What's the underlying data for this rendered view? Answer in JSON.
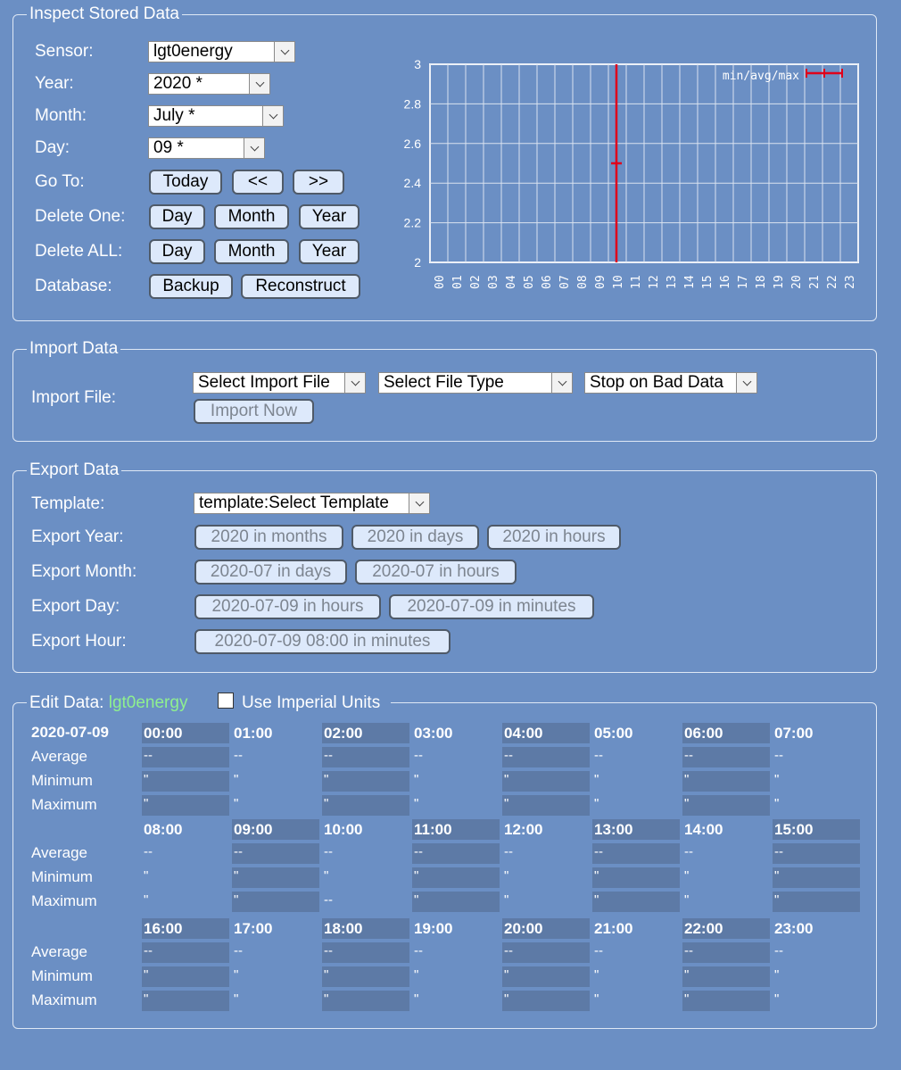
{
  "inspect": {
    "legend": "Inspect Stored Data",
    "labels": {
      "sensor": "Sensor:",
      "year": "Year:",
      "month": "Month:",
      "day": "Day:",
      "goto": "Go To:",
      "delete_one": "Delete One:",
      "delete_all": "Delete ALL:",
      "database": "Database:"
    },
    "sensor_value": "lgt0energy",
    "year_value": "2020 *",
    "month_value": "July *",
    "day_value": "09 *",
    "goto_buttons": [
      "Today",
      "<<",
      ">>"
    ],
    "delete_buttons": [
      "Day",
      "Month",
      "Year"
    ],
    "database_buttons": [
      "Backup",
      "Reconstruct"
    ]
  },
  "chart_data": {
    "type": "line",
    "legend": "min/avg/max",
    "categories": [
      "00",
      "01",
      "02",
      "03",
      "04",
      "05",
      "06",
      "07",
      "08",
      "09",
      "10",
      "11",
      "12",
      "13",
      "14",
      "15",
      "16",
      "17",
      "18",
      "19",
      "20",
      "21",
      "22",
      "23"
    ],
    "yticks": [
      "3",
      "2.8",
      "2.6",
      "2.4",
      "2.2",
      "2"
    ],
    "ylim": [
      2,
      3
    ],
    "series": [
      {
        "name": "min/avg/max",
        "points": [
          {
            "x": "10",
            "min": 2.0,
            "avg": 2.5,
            "max": 3.0
          }
        ]
      }
    ],
    "grid": true,
    "legend_position": "top-right",
    "color": "#e0001b"
  },
  "import": {
    "legend": "Import Data",
    "label": "Import File:",
    "file_select": "Select Import File",
    "type_select": "Select File Type",
    "bad_data_select": "Stop on Bad Data",
    "import_button": "Import Now"
  },
  "export": {
    "legend": "Export Data",
    "labels": {
      "template": "Template:",
      "year": "Export Year:",
      "month": "Export Month:",
      "day": "Export Day:",
      "hour": "Export Hour:"
    },
    "template_select": "template:Select Template",
    "year_buttons": [
      "2020 in months",
      "2020 in days",
      "2020 in hours"
    ],
    "month_buttons": [
      "2020-07 in days",
      "2020-07 in hours"
    ],
    "day_buttons": [
      "2020-07-09 in hours",
      "2020-07-09 in minutes"
    ],
    "hour_buttons": [
      "2020-07-09 08:00 in minutes"
    ]
  },
  "edit": {
    "legend_prefix": "Edit Data: ",
    "sensor": "lgt0energy",
    "imperial_label": "Use Imperial Units",
    "date": "2020-07-09",
    "row_labels": [
      "Average",
      "Minimum",
      "Maximum"
    ],
    "hours": [
      "00:00",
      "01:00",
      "02:00",
      "03:00",
      "04:00",
      "05:00",
      "06:00",
      "07:00",
      "08:00",
      "09:00",
      "10:00",
      "11:00",
      "12:00",
      "13:00",
      "14:00",
      "15:00",
      "16:00",
      "17:00",
      "18:00",
      "19:00",
      "20:00",
      "21:00",
      "22:00",
      "23:00"
    ],
    "avg_value": "--",
    "min_value": "\"",
    "max_value": "\"",
    "max_value_10": "--"
  },
  "colors": {
    "background": "#6b8fc4",
    "sensor_green": "#8ff08f",
    "cell_dark": "#5d7aa6"
  }
}
